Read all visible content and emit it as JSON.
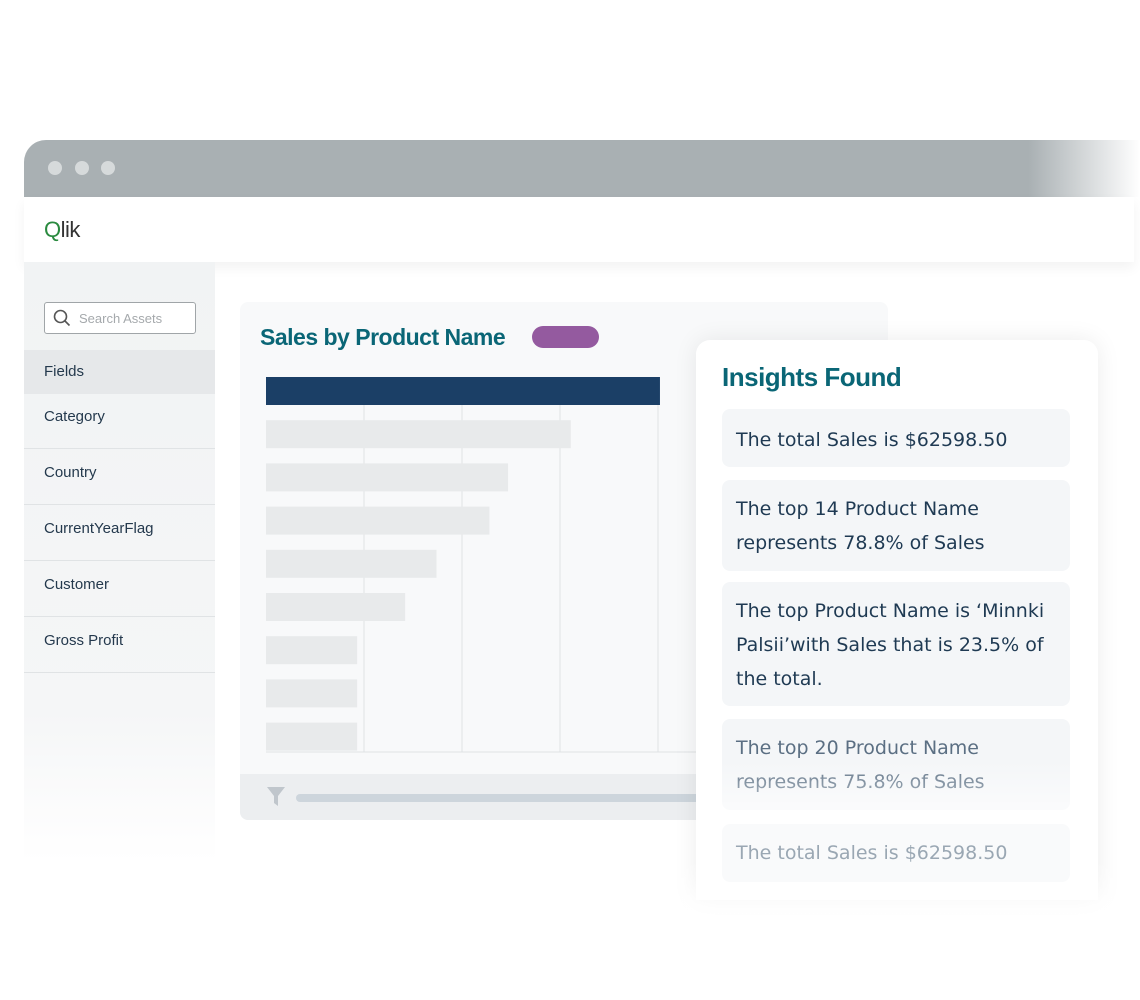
{
  "header": {
    "logo": "Qlik"
  },
  "sidebar": {
    "search_placeholder": "Search Assets",
    "items": [
      {
        "label": "Fields"
      },
      {
        "label": "Category"
      },
      {
        "label": "Country"
      },
      {
        "label": "CurrentYearFlag"
      },
      {
        "label": "Customer"
      },
      {
        "label": "Gross Profit"
      }
    ]
  },
  "chart_data": {
    "type": "bar",
    "orientation": "horizontal",
    "title": "Sales by Product Name",
    "values": [
      4.02,
      3.11,
      2.47,
      2.28,
      1.74,
      1.42,
      0.93,
      0.93,
      0.93
    ],
    "xlim": [
      0,
      4
    ],
    "grid": true,
    "colors": {
      "highlight": "#1b3f66",
      "bar": "#e8eaeb",
      "pill": "#945a9f"
    }
  },
  "insights": {
    "title": "Insights Found",
    "items": [
      "The total Sales is $62598.50",
      "The top 14 Product Name represents 78.8% of Sales",
      "The top Product Name is ‘Minnki Palsii’with Sales that is 23.5% of the total.",
      "The top 20 Product Name represents 75.8% of Sales",
      "The total Sales is $62598.50"
    ]
  },
  "colors": {
    "accent": "#0a6676",
    "logo_green": "#2a8a3f",
    "titlebar": "#a9b0b3"
  }
}
